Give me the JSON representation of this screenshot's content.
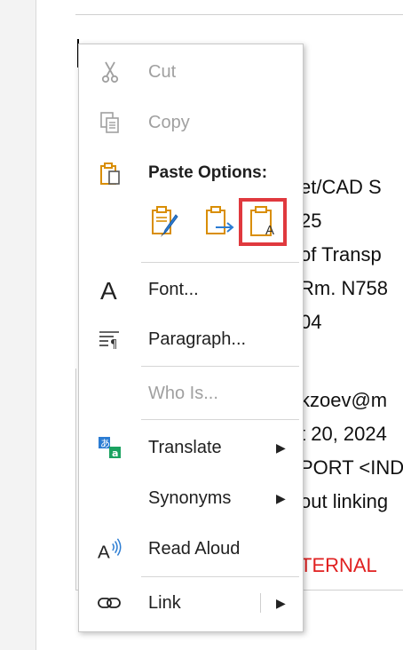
{
  "document": {
    "lines": [
      "et/CAD S",
      "25",
      "of Transp",
      "Rm. N758",
      "04",
      "kzoev@m",
      "t 20, 2024",
      "PORT <IND",
      "out linking",
      "TERNAL"
    ]
  },
  "menu": {
    "cut": "Cut",
    "copy": "Copy",
    "paste_options": "Paste Options:",
    "font": "Font...",
    "paragraph": "Paragraph...",
    "who_is": "Who Is...",
    "translate": "Translate",
    "synonyms": "Synonyms",
    "read_aloud": "Read Aloud",
    "link": "Link",
    "paste_keep_text": "A",
    "read_aloud_icon_text": "A"
  },
  "colors": {
    "selection_outline": "#e0393e",
    "paste_orange": "#d98e04",
    "accent_blue": "#2b7cd3",
    "disabled_text": "#a0a0a0"
  }
}
